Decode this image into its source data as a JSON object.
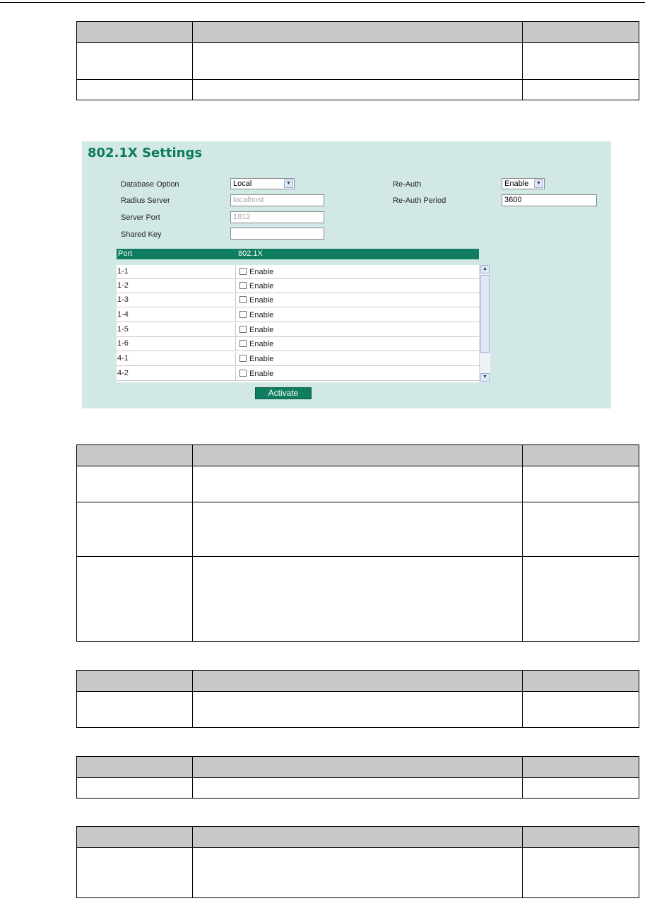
{
  "panel": {
    "title": "802.1X Settings",
    "database_option": {
      "label": "Database Option",
      "value": "Local"
    },
    "radius_server": {
      "label": "Radius Server",
      "value": "localhost"
    },
    "server_port": {
      "label": "Server Port",
      "value": "1812"
    },
    "shared_key": {
      "label": "Shared Key",
      "value": ""
    },
    "re_auth": {
      "label": "Re-Auth",
      "value": "Enable"
    },
    "re_auth_period": {
      "label": "Re-Auth Period",
      "value": "3600"
    },
    "table": {
      "headers": [
        "Port",
        "802.1X"
      ],
      "rows": [
        {
          "port": "1-1",
          "option": "Enable"
        },
        {
          "port": "1-2",
          "option": "Enable"
        },
        {
          "port": "1-3",
          "option": "Enable"
        },
        {
          "port": "1-4",
          "option": "Enable"
        },
        {
          "port": "1-5",
          "option": "Enable"
        },
        {
          "port": "1-6",
          "option": "Enable"
        },
        {
          "port": "4-1",
          "option": "Enable"
        },
        {
          "port": "4-2",
          "option": "Enable"
        }
      ]
    },
    "activate_label": "Activate"
  },
  "colors": {
    "panel_bg": "#d2e8e6",
    "accent": "#0f7d5f",
    "table_header_grey": "#c8c8c8"
  }
}
